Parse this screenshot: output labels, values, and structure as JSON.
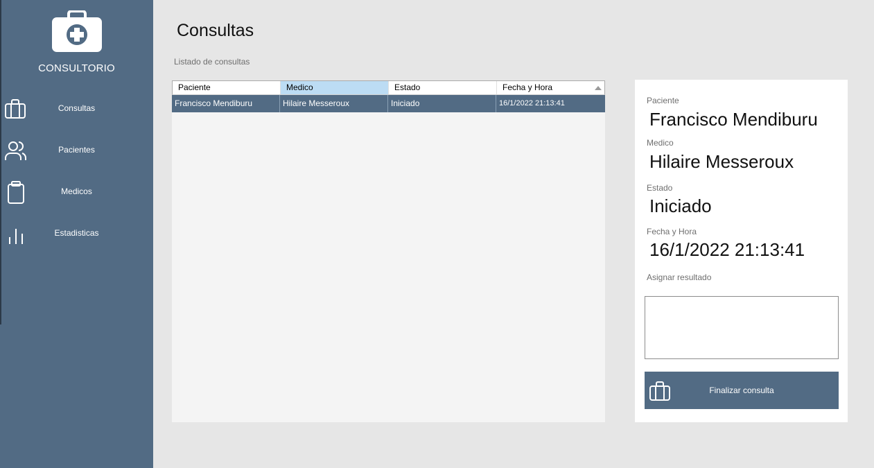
{
  "sidebar": {
    "brand": "CONSULTORIO",
    "items": [
      {
        "label": "Consultas",
        "icon": "briefcase-icon"
      },
      {
        "label": "Pacientes",
        "icon": "users-icon"
      },
      {
        "label": "Medicos",
        "icon": "clipboard-icon"
      },
      {
        "label": "Estadisticas",
        "icon": "bar-chart-icon"
      }
    ]
  },
  "main": {
    "title": "Consultas",
    "subtitle": "Listado de consultas"
  },
  "table": {
    "columns": [
      "Paciente",
      "Medico",
      "Estado",
      "Fecha y Hora"
    ],
    "rows": [
      [
        "Francisco Mendiburu",
        "Hilaire Messeroux",
        "Iniciado",
        "16/1/2022 21:13:41"
      ]
    ]
  },
  "detail": {
    "paciente_label": "Paciente",
    "paciente_value": "Francisco Mendiburu",
    "medico_label": "Medico",
    "medico_value": "Hilaire Messeroux",
    "estado_label": "Estado",
    "estado_value": "Iniciado",
    "fecha_label": "Fecha y Hora",
    "fecha_value": "16/1/2022 21:13:41",
    "resultado_label": "Asignar resultado",
    "resultado_value": "",
    "finish_label": "Finalizar consulta"
  },
  "colors": {
    "sidebar": "#526b84",
    "selected_header": "#bcdcf4",
    "background": "#e6e6e6"
  }
}
